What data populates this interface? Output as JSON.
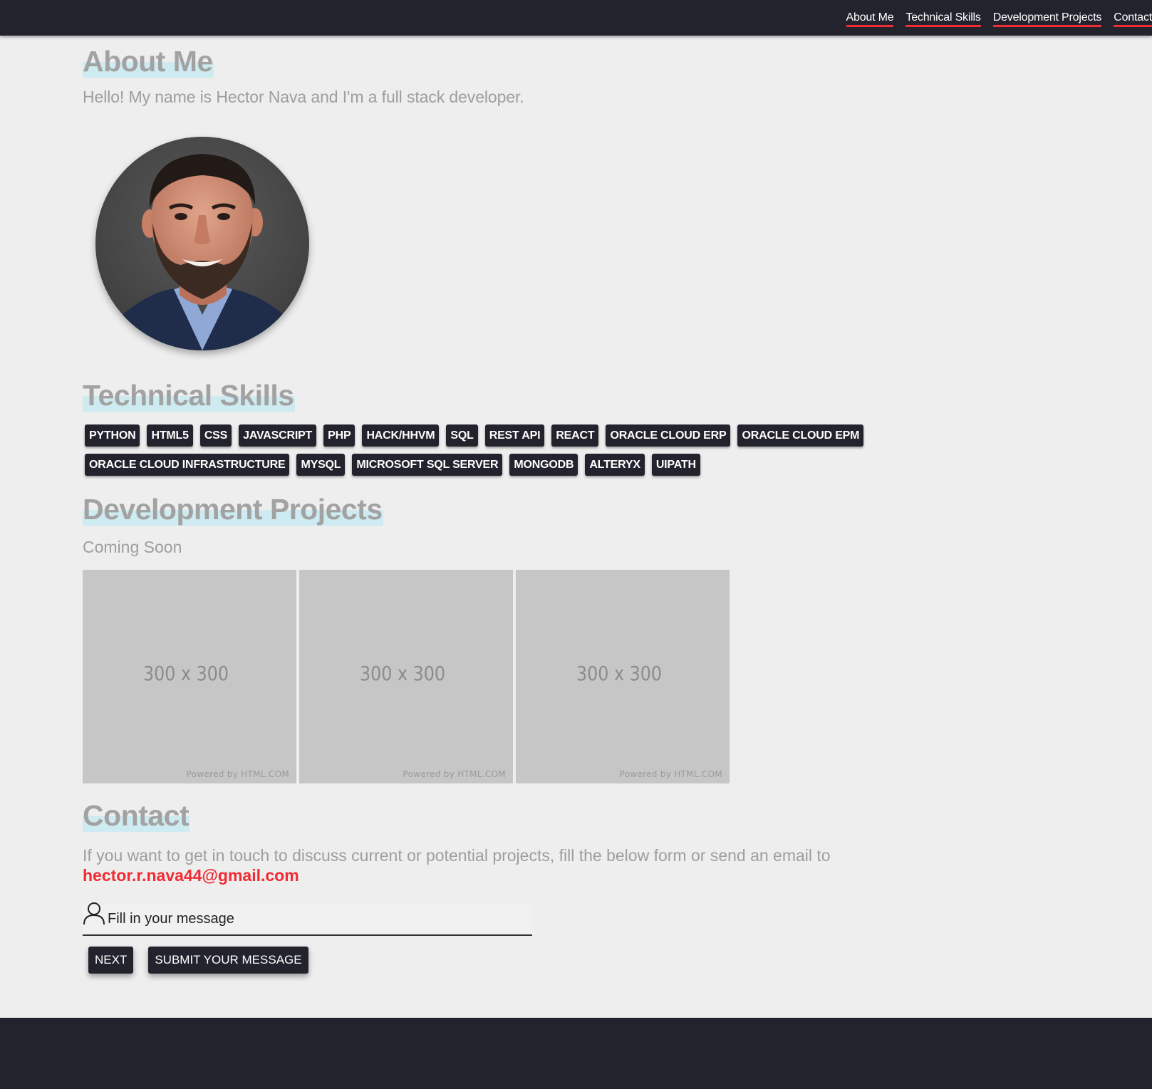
{
  "nav": {
    "items": [
      {
        "label": "About Me"
      },
      {
        "label": "Technical Skills"
      },
      {
        "label": "Development Projects"
      },
      {
        "label": "Contact"
      }
    ]
  },
  "about": {
    "title": "About Me",
    "text": "Hello! My name is Hector Nava and I'm a full stack developer."
  },
  "skills": {
    "title": "Technical Skills",
    "items": [
      "PYTHON",
      "HTML5",
      "CSS",
      "JAVASCRIPT",
      "PHP",
      "HACK/HHVM",
      "SQL",
      "REST API",
      "REACT",
      "ORACLE CLOUD ERP",
      "ORACLE CLOUD EPM",
      "ORACLE CLOUD INFRASTRUCTURE",
      "MYSQL",
      "MICROSOFT SQL SERVER",
      "MONGODB",
      "ALTERYX",
      "UIPATH"
    ]
  },
  "projects": {
    "title": "Development Projects",
    "text": "Coming Soon",
    "placeholders": [
      {
        "label": "300 x 300",
        "credit": "Powered by HTML.COM"
      },
      {
        "label": "300 x 300",
        "credit": "Powered by HTML.COM"
      },
      {
        "label": "300 x 300",
        "credit": "Powered by HTML.COM"
      }
    ]
  },
  "contact": {
    "title": "Contact",
    "text": "If you want to get in touch to discuss current or potential projects, fill the below form or send an email to",
    "email": "hector.r.nava44@gmail.com",
    "message_placeholder": "Fill in your message",
    "next_label": "NEXT",
    "submit_label": "SUBMIT YOUR MESSAGE"
  },
  "icons": {
    "user": "user-outline-icon"
  },
  "colors": {
    "nav_bg": "#23232e",
    "accent": "#f02c34",
    "page_bg": "#eeeeee",
    "title_text": "#a2a2a2",
    "title_highlight": "#cdebf0",
    "chip_bg": "#23232e",
    "placeholder_tile": "#c6c6c6"
  }
}
